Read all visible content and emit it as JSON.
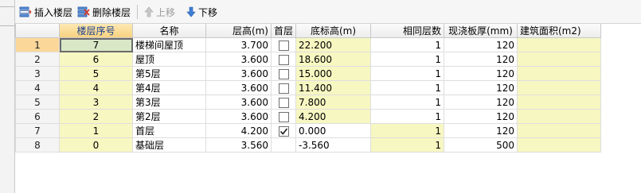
{
  "toolbar": {
    "insert_floor": "插入楼层",
    "delete_floor": "删除楼层",
    "move_up": "上移",
    "move_down": "下移"
  },
  "columns": {
    "rownum": "",
    "seq": "楼层序号",
    "name": "名称",
    "height": "层高(m)",
    "first": "首层",
    "elev": "底标高(m)",
    "same": "相同层数",
    "slab": "现浇板厚(mm)",
    "area": "建筑面积(m2)"
  },
  "rows": [
    {
      "rownum": "1",
      "seq": "7",
      "name": "楼梯间屋顶",
      "height": "3.700",
      "first": false,
      "elev": "22.200",
      "same": "1",
      "slab": "120",
      "area": ""
    },
    {
      "rownum": "2",
      "seq": "6",
      "name": "屋顶",
      "height": "3.600",
      "first": false,
      "elev": "18.600",
      "same": "1",
      "slab": "120",
      "area": ""
    },
    {
      "rownum": "3",
      "seq": "5",
      "name": "第5层",
      "height": "3.600",
      "first": false,
      "elev": "15.000",
      "same": "1",
      "slab": "120",
      "area": ""
    },
    {
      "rownum": "4",
      "seq": "4",
      "name": "第4层",
      "height": "3.600",
      "first": false,
      "elev": "11.400",
      "same": "1",
      "slab": "120",
      "area": ""
    },
    {
      "rownum": "5",
      "seq": "3",
      "name": "第3层",
      "height": "3.600",
      "first": false,
      "elev": "7.800",
      "same": "1",
      "slab": "120",
      "area": ""
    },
    {
      "rownum": "6",
      "seq": "2",
      "name": "第2层",
      "height": "3.600",
      "first": false,
      "elev": "4.200",
      "same": "1",
      "slab": "120",
      "area": ""
    },
    {
      "rownum": "7",
      "seq": "1",
      "name": "首层",
      "height": "4.200",
      "first": true,
      "elev": "0.000",
      "same": "1",
      "slab": "120",
      "area": ""
    },
    {
      "rownum": "8",
      "seq": "0",
      "name": "基础层",
      "height": "3.560",
      "first": false,
      "elev": "-3.560",
      "same": "1",
      "slab": "500",
      "area": ""
    }
  ],
  "selected_row": 0,
  "colors": {
    "editable_cell": "#f7f7c2",
    "selected_row_header": "#fbd89a",
    "selected_cell": "#d9e7c7",
    "seq_header": "#f7d27f",
    "disabled_text": "#9a9a9a"
  },
  "icons": {
    "insert_floor": "insert-floor-icon",
    "delete_floor": "delete-floor-icon",
    "move_up": "arrow-up-icon",
    "move_down": "arrow-down-icon",
    "checkbox_checked": "checkmark-icon"
  }
}
